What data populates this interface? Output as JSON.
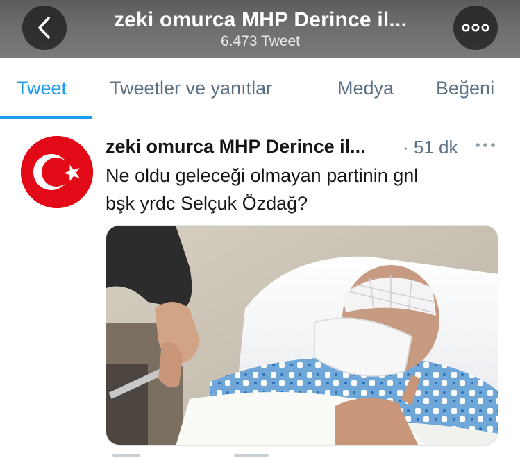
{
  "header": {
    "title": "zeki omurca MHP Derince il...",
    "subtitle": "6.473 Tweet",
    "back_icon": "chevron-left-icon",
    "more_icon": "more-horizontal-icon"
  },
  "tabs": [
    {
      "label": "Tweet",
      "active": true
    },
    {
      "label": "Tweetler ve yanıtlar",
      "active": false
    },
    {
      "label": "Medya",
      "active": false
    },
    {
      "label": "Beğeni",
      "active": false
    }
  ],
  "tweet": {
    "author_name": "zeki omurca MHP Derince il...",
    "time": "· 51 dk",
    "text_lines": [
      "Ne oldu geleceği olmayan partinin gnl",
      "bşk yrdc Selçuk Özdağ?"
    ],
    "avatar_icon": "turkish-flag-icon",
    "media_description_icon": "photo-hospital-bed-icon"
  },
  "colors": {
    "accent": "#1d9bf0",
    "tab_inactive": "#5b7083",
    "flag_red": "#e30a17"
  }
}
